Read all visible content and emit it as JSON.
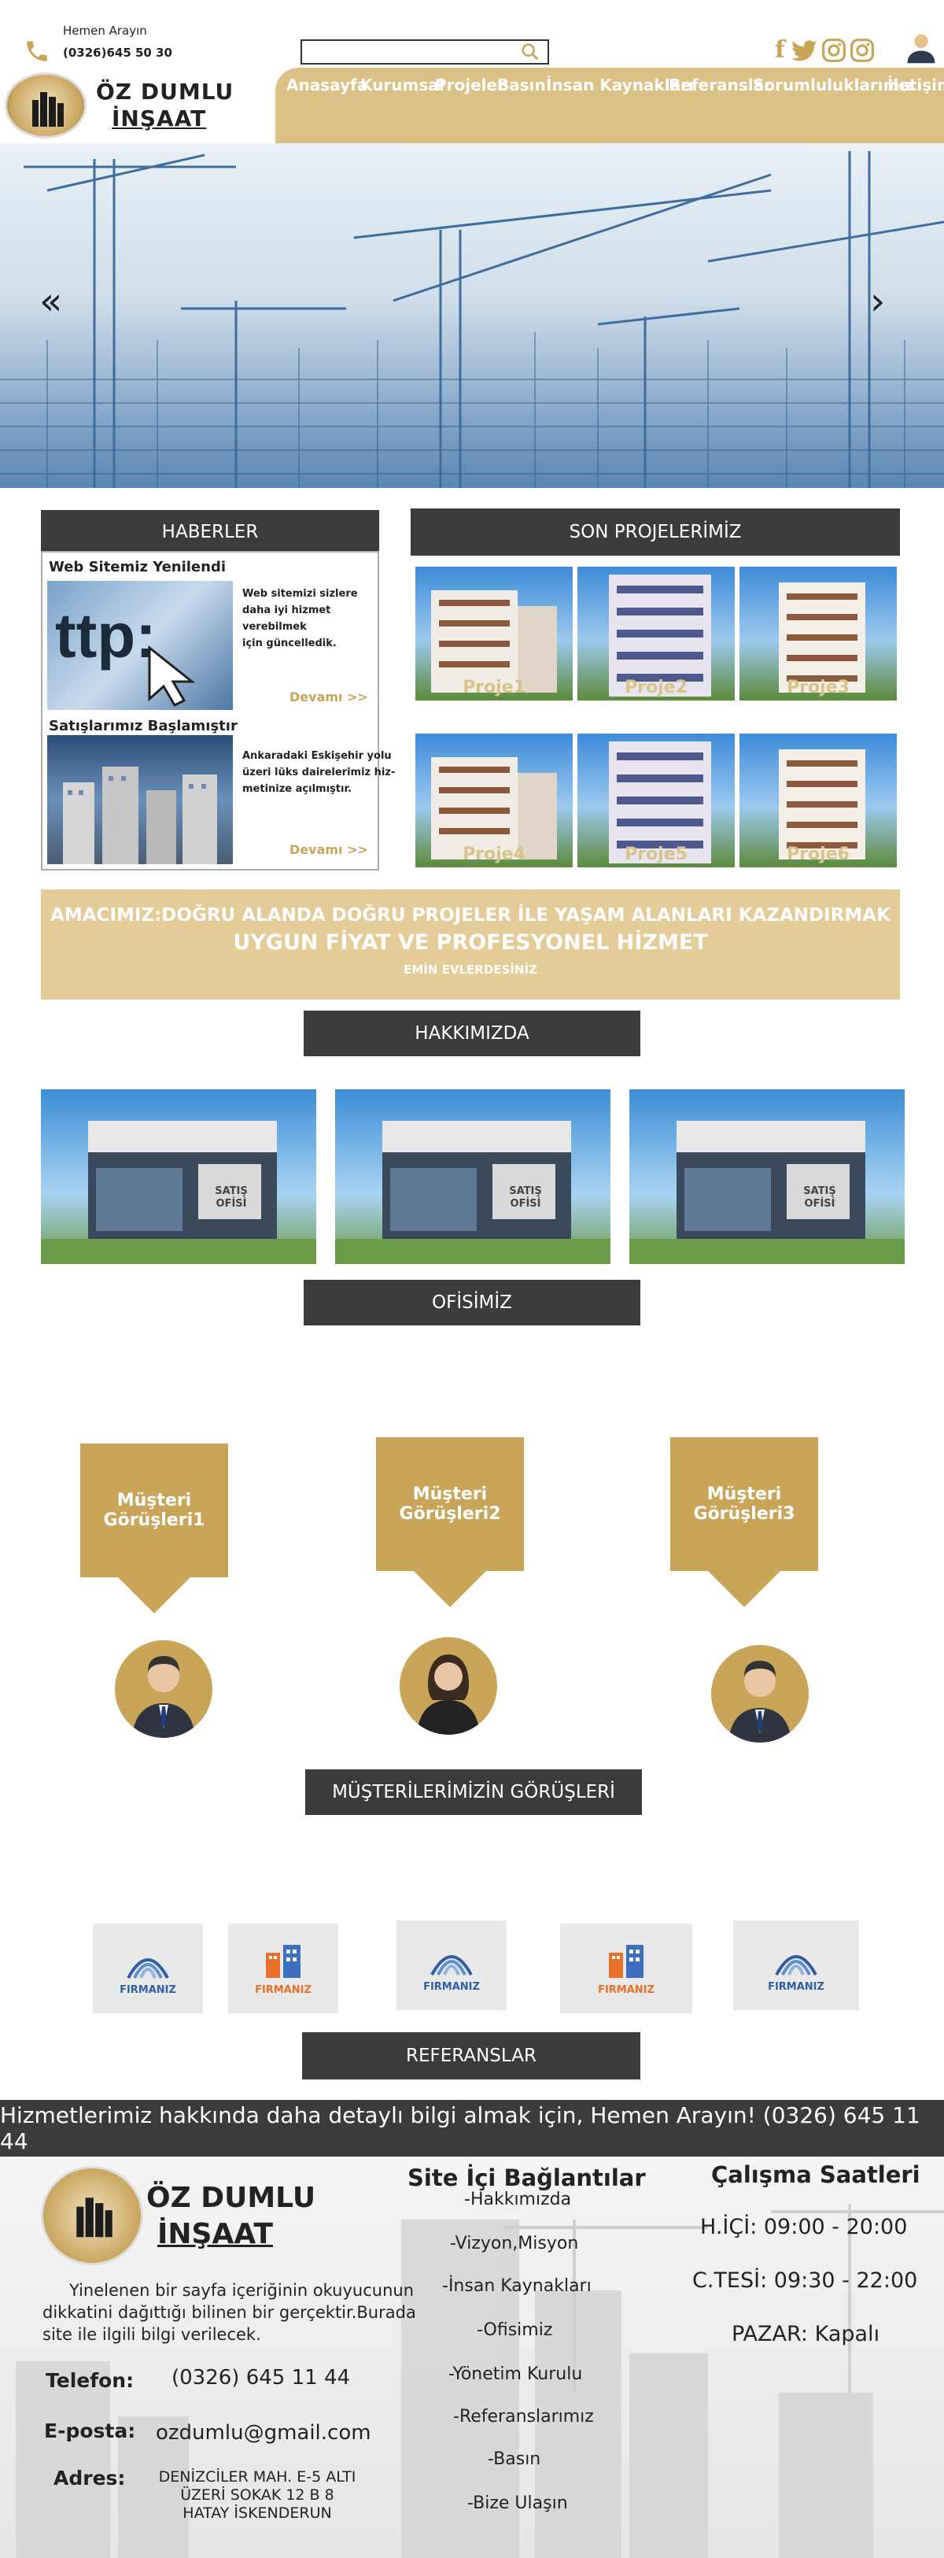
{
  "header": {
    "phone_label": "Hemen Arayın",
    "phone_number": "(0326)645 50 30",
    "logo_line1": "ÖZ DUMLU",
    "logo_line2": "İNŞAAT",
    "search_placeholder": "",
    "social_icons": [
      "facebook-icon",
      "twitter-icon",
      "instagram-icon",
      "instagram-icon"
    ],
    "nav": [
      "Anasayfa",
      "Kurumsal",
      "Projeler",
      "Basın",
      "İnsan Kaynakları",
      "Referanslar",
      "Sorumluluklarımız",
      "İletişim"
    ]
  },
  "hero": {
    "prev_arrow": "«",
    "next_arrow": "›"
  },
  "news": {
    "title": "HABERLER",
    "items": [
      {
        "heading": "Web  Sitemiz Yenilendi",
        "body": [
          "Web sitemizi sizlere",
          "daha iyi hizmet",
          "verebilmek",
          "için güncelledik."
        ],
        "more": "Devamı >>"
      },
      {
        "heading": "Satışlarımız Başlamıştır",
        "body": [
          "Ankaradaki Eskişehir yolu",
          "üzeri lüks dairelerimiz hiz-",
          "metinize açılmıştır."
        ],
        "more": "Devamı >>"
      }
    ]
  },
  "projects": {
    "title": "SON PROJELERİMİZ",
    "items": [
      "Proje1",
      "Proje2",
      "Proje3",
      "Proje4",
      "Proje5",
      "Proje6"
    ]
  },
  "banner": {
    "line1": "AMACIMIZ:DOĞRU ALANDA DOĞRU PROJELER İLE YAŞAM ALANLARI KAZANDIRMAK",
    "line2": "UYGUN FİYAT VE PROFESYONEL HİZMET",
    "line3": "EMİN EVLERDESİNİZ"
  },
  "about_title": "HAKKIMIZDA",
  "office": {
    "sign": [
      "SATIŞ",
      "OFİSİ"
    ],
    "title": "OFİSİMİZ"
  },
  "testimonials": {
    "items": [
      "Müşteri Görüşleri1",
      "Müşteri Görüşleri2",
      "Müşteri Görüşleri3"
    ],
    "title": "MÜŞTERİLERİMİZİN GÖRÜŞLERİ"
  },
  "references": {
    "items": [
      "FIRMANIZ",
      "FIRMANIZ",
      "FIRMANIZ",
      "FIRMANIZ",
      "FIRMANIZ"
    ],
    "title": "REFERANSLAR"
  },
  "cta": "Hizmetlerimiz hakkında daha detaylı bilgi almak için, Hemen Arayın! (0326) 645 11 44",
  "footer": {
    "logo_line1": "ÖZ DUMLU",
    "logo_line2": "İNŞAAT",
    "about_text": [
      "Yinelenen bir sayfa içeriğinin okuyucunun",
      "dikkatini dağıttığı bilinen bir gerçektir.Burada",
      "site ile ilgili  bilgi verilecek."
    ],
    "phone_label": "Telefon:",
    "phone_value": "(0326) 645 11 44",
    "email_label": "E-posta:",
    "email_value": "ozdumlu@gmail.com",
    "address_label": "Adres:",
    "address_lines": [
      "DENİZCİLER MAH. E-5 ALTI",
      "ÜZERİ SOKAK 12 B 8",
      "HATAY İSKENDERUN"
    ],
    "links_title": "Site İçi Bağlantılar",
    "links": [
      "-Hakkımızda",
      "-Vizyon,Misyon",
      "-İnsan Kaynakları",
      "-Ofisimiz",
      "-Yönetim Kurulu",
      "-Referanslarımız",
      "-Basın",
      "-Bize Ulaşın"
    ],
    "hours_title": "Çalışma Saatleri",
    "hours": [
      "H.İÇİ: 09:00 - 20:00",
      "C.TESİ: 09:30 - 22:00",
      "PAZAR: Kapalı"
    ]
  },
  "colors": {
    "gold": "#c9a55a",
    "dark": "#3b3b3b",
    "nav_bg": "#dcc186",
    "banner_bg": "#e3cc97"
  }
}
